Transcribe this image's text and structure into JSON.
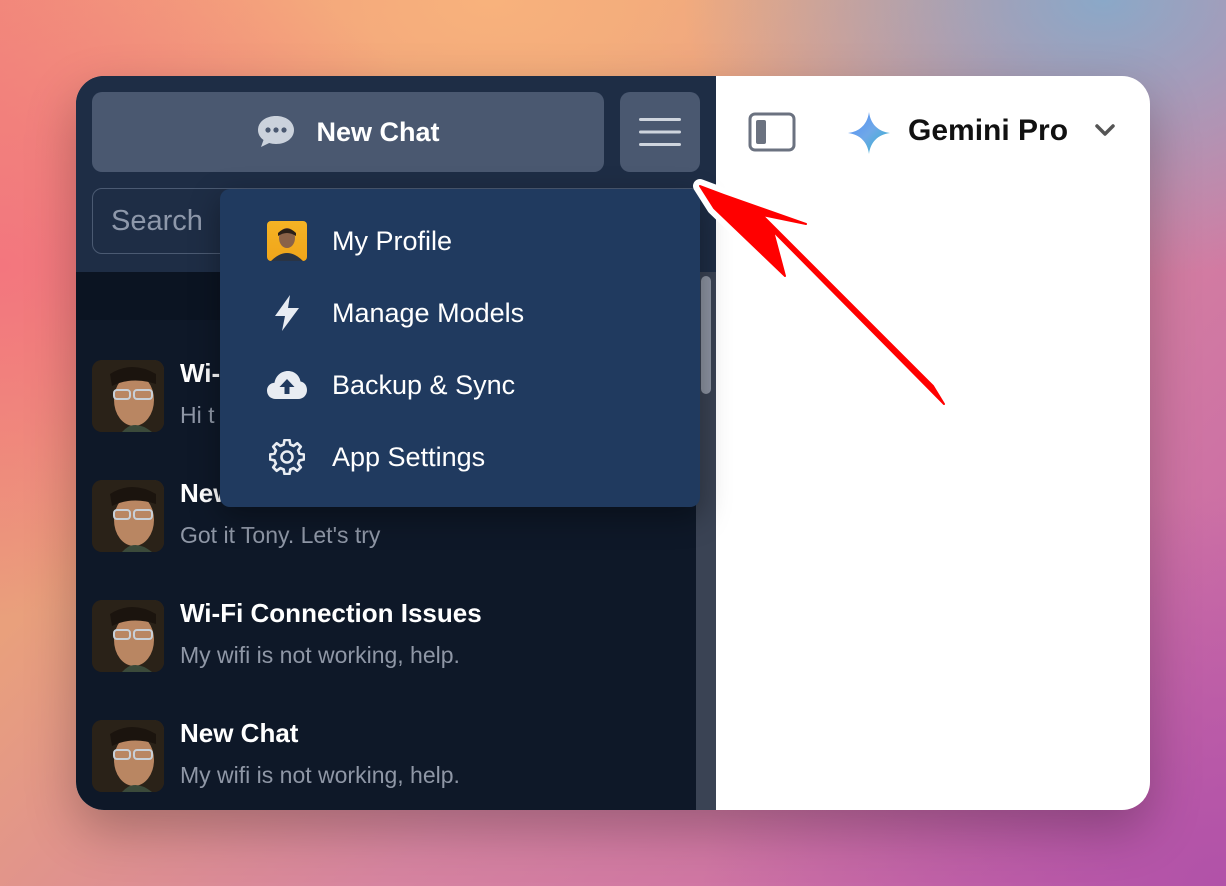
{
  "sidebar": {
    "new_chat_label": "New Chat",
    "search_placeholder": "Search",
    "chats": [
      {
        "title": "Wi-",
        "subtitle": "Hi t"
      },
      {
        "title": "New",
        "subtitle": "Got it Tony. Let's try"
      },
      {
        "title": "Wi-Fi Connection Issues",
        "subtitle": "My wifi is not working, help."
      },
      {
        "title": "New Chat",
        "subtitle": "My wifi is not working, help."
      }
    ]
  },
  "menu": {
    "items": [
      {
        "label": "My Profile",
        "icon": "profile-avatar"
      },
      {
        "label": "Manage Models",
        "icon": "lightning-icon"
      },
      {
        "label": "Backup & Sync",
        "icon": "cloud-upload-icon"
      },
      {
        "label": "App Settings",
        "icon": "gear-icon"
      }
    ]
  },
  "header": {
    "model_name": "Gemini Pro"
  },
  "colors": {
    "sidebar_bg": "#0e1828",
    "sidebar_top_bg": "#1e2d45",
    "button_bg": "#4a5870",
    "dropdown_bg": "#203a5f",
    "annotation_arrow": "#ff0000"
  }
}
